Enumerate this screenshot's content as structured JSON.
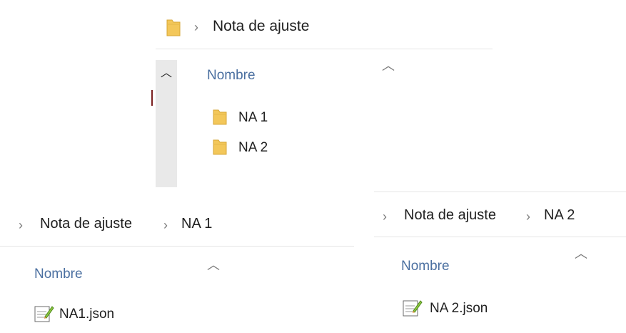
{
  "panel_1": {
    "breadcrumb": [
      "Nota de ajuste"
    ],
    "column_header": "Nombre",
    "items": [
      {
        "name": "NA 1",
        "icon": "folder-icon"
      },
      {
        "name": "NA 2",
        "icon": "folder-icon"
      }
    ]
  },
  "panel_2": {
    "breadcrumb": [
      "Nota de ajuste",
      "NA 1"
    ],
    "column_header": "Nombre",
    "items": [
      {
        "name": "NA1.json",
        "icon": "json-file-icon"
      }
    ]
  },
  "panel_3": {
    "breadcrumb": [
      "Nota de ajuste",
      "NA 2"
    ],
    "column_header": "Nombre",
    "items": [
      {
        "name": "NA 2.json",
        "icon": "json-file-icon"
      }
    ]
  },
  "colors": {
    "folder": "#f3c75a",
    "header_text": "#4a6fa0",
    "chevron": "#7a7a7a",
    "scrollbar": "#e9e9e9"
  }
}
